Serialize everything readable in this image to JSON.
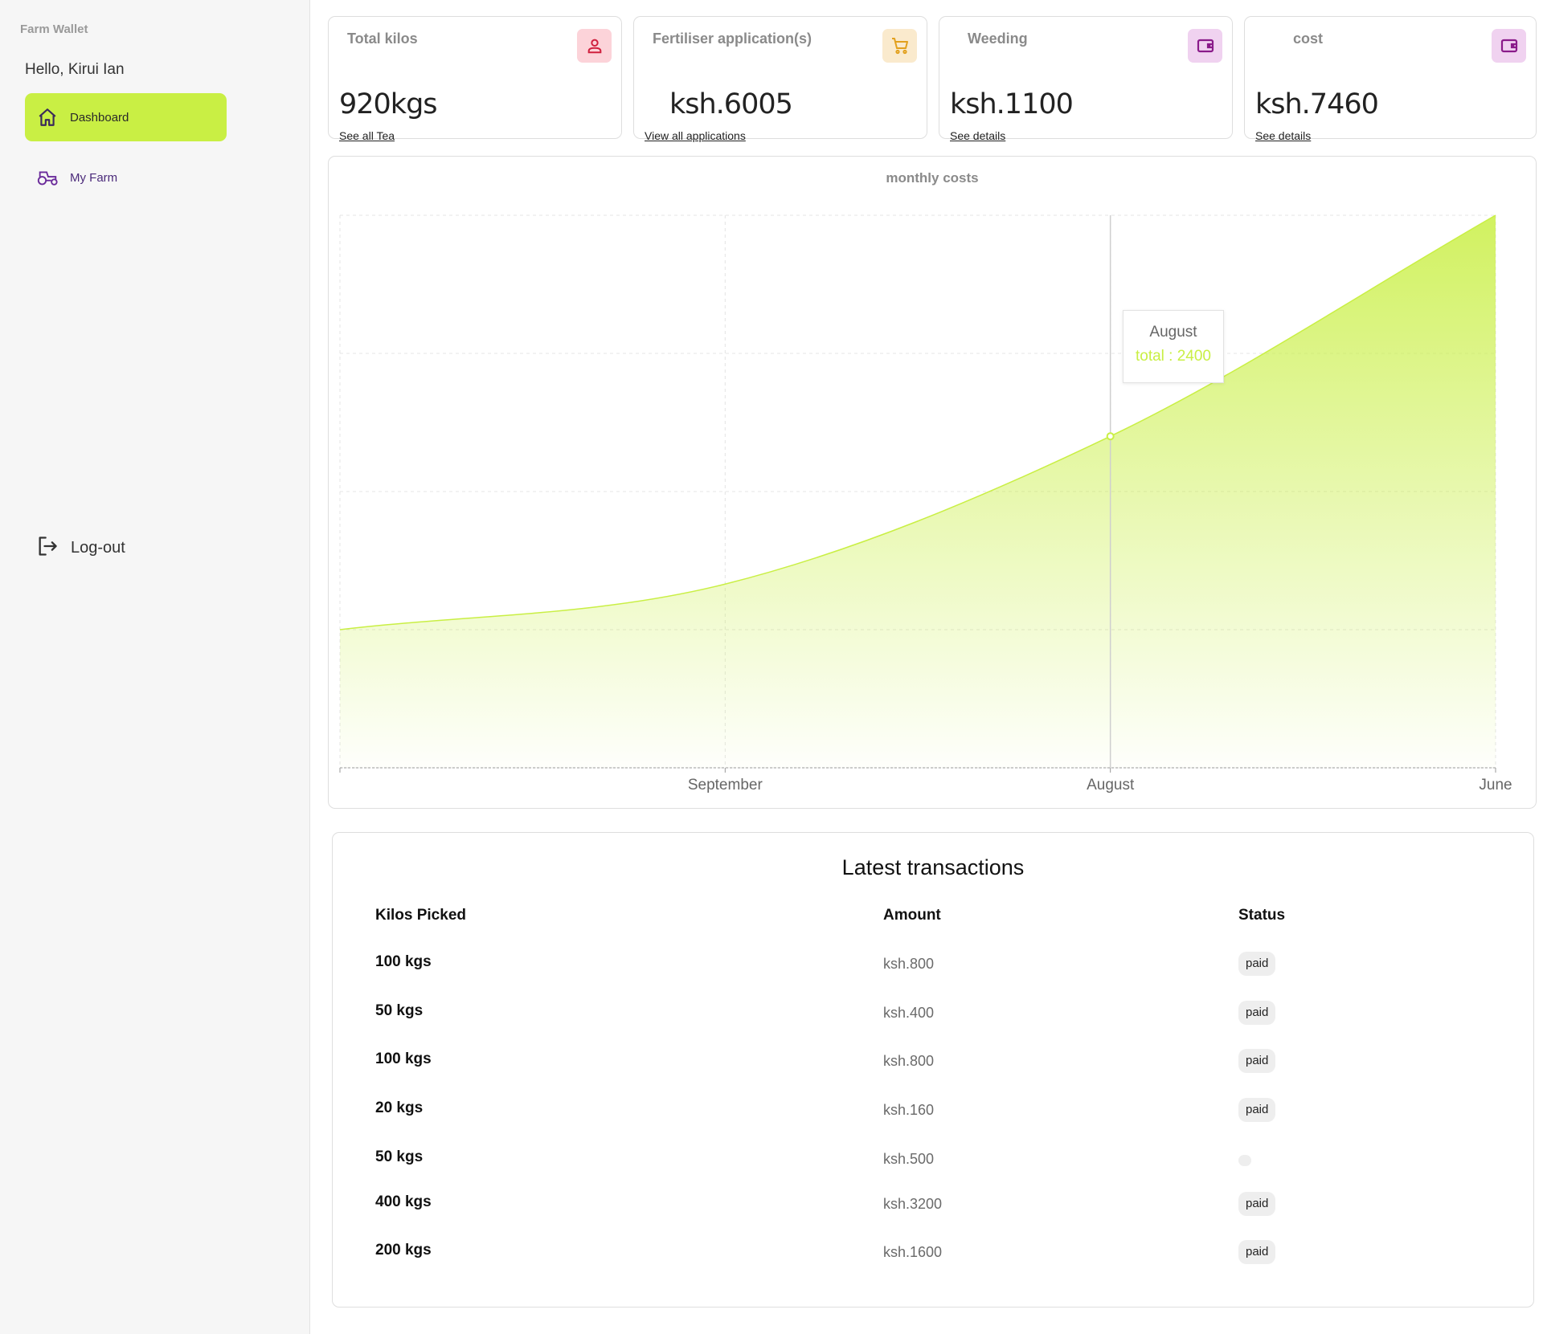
{
  "sidebar": {
    "brand": "Farm Wallet",
    "greeting": "Hello, Kirui Ian",
    "items": [
      {
        "label": "Dashboard",
        "icon": "home-icon",
        "active": true
      },
      {
        "label": "My Farm",
        "icon": "tractor-icon",
        "active": false
      }
    ],
    "logout": {
      "label": "Log-out",
      "icon": "logout-icon"
    }
  },
  "cards": [
    {
      "title": "Total kilos",
      "value": "920kgs",
      "link": "See all Tea",
      "icon": "person-icon",
      "badge_color": "#fcd3d9",
      "icon_color": "#d0203e"
    },
    {
      "title": "Fertiliser application(s)",
      "value": "ksh.6005",
      "link": "View all applications",
      "icon": "cart-icon",
      "badge_color": "#faeacd",
      "icon_color": "#e2a01d"
    },
    {
      "title": "Weeding",
      "value": "ksh.1100",
      "link": "See details",
      "icon": "wallet-icon",
      "badge_color": "#f0d2f0",
      "icon_color": "#8a1b8a"
    },
    {
      "title": "cost",
      "value": "ksh.7460",
      "link": "See details",
      "icon": "wallet-icon",
      "badge_color": "#f0d2f0",
      "icon_color": "#8a1b8a"
    }
  ],
  "chart_data": {
    "type": "area",
    "title": "monthly costs",
    "x": [
      "",
      "September",
      "August",
      "June"
    ],
    "series": [
      {
        "values": [
          1000,
          1330,
          2400,
          4000
        ]
      }
    ],
    "ylim": [
      0,
      4000
    ],
    "grid": true,
    "color": "#c9ef44",
    "tooltip": {
      "month": "August",
      "text": "total : 2400"
    }
  },
  "transactions": {
    "title": "Latest transactions",
    "headers": [
      "Kilos Picked",
      "Amount",
      "Status"
    ],
    "rows": [
      {
        "kilos": "100 kgs",
        "amount": "ksh.800",
        "status": "paid"
      },
      {
        "kilos": "50 kgs",
        "amount": "ksh.400",
        "status": "paid"
      },
      {
        "kilos": "100 kgs",
        "amount": "ksh.800",
        "status": "paid"
      },
      {
        "kilos": "20 kgs",
        "amount": "ksh.160",
        "status": "paid"
      },
      {
        "kilos": "50 kgs",
        "amount": "ksh.500",
        "status": ""
      },
      {
        "kilos": "400 kgs",
        "amount": "ksh.3200",
        "status": "paid"
      },
      {
        "kilos": "200 kgs",
        "amount": "ksh.1600",
        "status": "paid"
      }
    ]
  }
}
